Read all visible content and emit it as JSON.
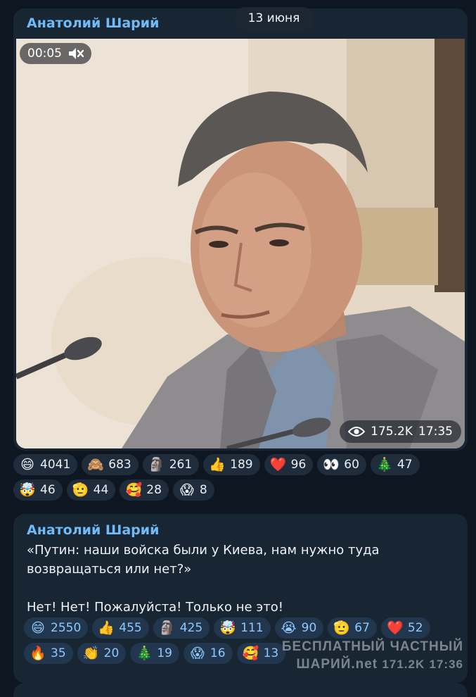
{
  "date_separator": "13 июня",
  "post1": {
    "author": "Анатолий Шарий",
    "video": {
      "duration": "00:05",
      "muted_icon": "speaker-muted-icon",
      "views": "175.2K",
      "time": "17:35"
    },
    "reactions": [
      {
        "emoji": "😄",
        "count": "4041"
      },
      {
        "emoji": "🙈",
        "count": "683"
      },
      {
        "emoji": "🗿",
        "count": "261"
      },
      {
        "emoji": "👍",
        "count": "189"
      },
      {
        "emoji": "❤️",
        "count": "96"
      },
      {
        "emoji": "👀",
        "count": "60"
      },
      {
        "emoji": "🎄",
        "count": "47"
      },
      {
        "emoji": "🤯",
        "count": "46"
      },
      {
        "emoji": "🫡",
        "count": "44"
      },
      {
        "emoji": "🥰",
        "count": "28"
      },
      {
        "emoji": "😱",
        "count": "8"
      }
    ]
  },
  "post2": {
    "author": "Анатолий Шарий",
    "text": "«Путин: наши войска были у Киева, нам нужно туда возвращаться или нет?»\n\nНет! Нет! Пожалуйста! Только не это!",
    "reactions": [
      {
        "emoji": "😄",
        "count": "2550"
      },
      {
        "emoji": "👍",
        "count": "455"
      },
      {
        "emoji": "🗿",
        "count": "425"
      },
      {
        "emoji": "🤯",
        "count": "111"
      },
      {
        "emoji": "😭",
        "count": "90"
      },
      {
        "emoji": "🫡",
        "count": "67"
      },
      {
        "emoji": "❤️",
        "count": "52"
      },
      {
        "emoji": "🔥",
        "count": "35"
      },
      {
        "emoji": "👏",
        "count": "20"
      },
      {
        "emoji": "🎄",
        "count": "19"
      },
      {
        "emoji": "😱",
        "count": "16"
      },
      {
        "emoji": "🥰",
        "count": "13"
      }
    ],
    "views": "171.2K",
    "time": "17:36"
  },
  "watermark": {
    "line1": "БЕСПЛАТНЫЙ ЧАСТНЫЙ",
    "line2": "ШАРИЙ.net"
  }
}
